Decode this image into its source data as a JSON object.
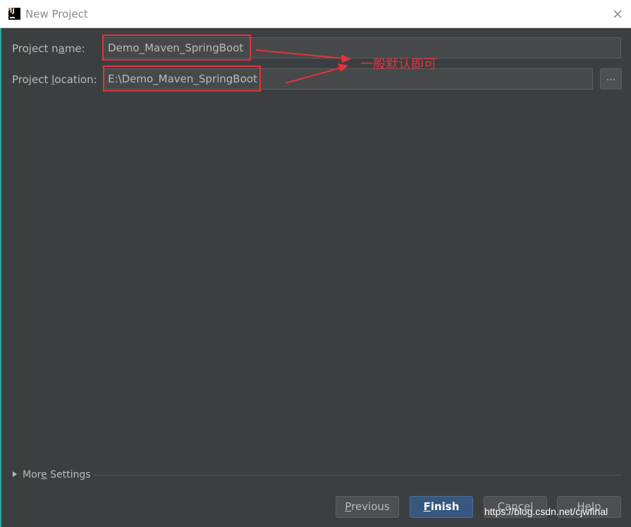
{
  "window": {
    "title": "New Project"
  },
  "form": {
    "name_label_pre": "Project n",
    "name_label_mn": "a",
    "name_label_post": "me:",
    "name_value": "Demo_Maven_SpringBoot",
    "location_label_pre": "Project ",
    "location_label_mn": "l",
    "location_label_post": "ocation:",
    "location_value": "E:\\Demo_Maven_SpringBoot",
    "browse_label": "..."
  },
  "annotation": {
    "text": "一般默认即可",
    "color": "#e8323c"
  },
  "more_settings": {
    "pre": "Mor",
    "mn": "e",
    "post": " Settings"
  },
  "buttons": {
    "previous_mn": "P",
    "previous_rest": "revious",
    "finish_mn": "F",
    "finish_rest": "inish",
    "cancel": "Cancel",
    "help": "Help"
  },
  "watermark": "https://blog.csdn.net/cjwfinal",
  "colors": {
    "background": "#3c3f41",
    "primary_button": "#365880",
    "annotation": "#e8323c"
  }
}
